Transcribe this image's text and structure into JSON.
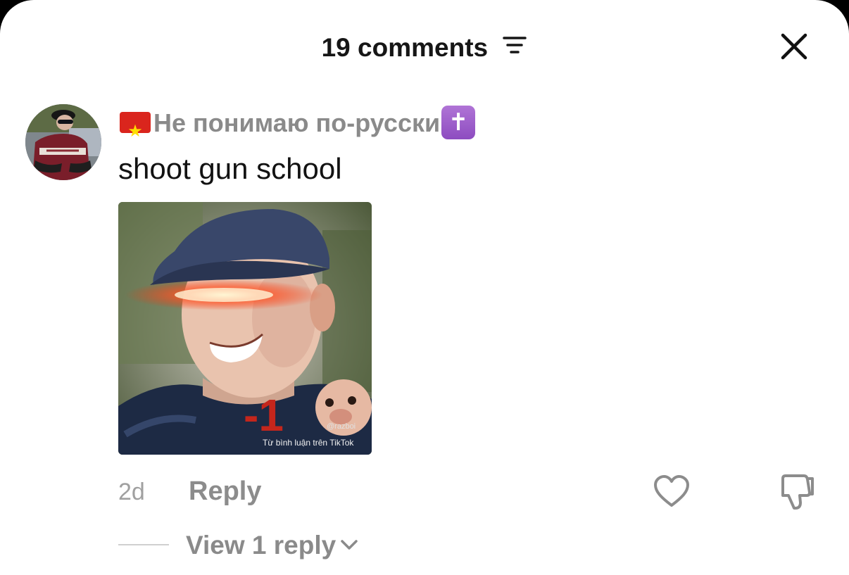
{
  "header": {
    "title": "19 comments"
  },
  "comment": {
    "username": "Не понимаю по-русски",
    "username_prefix_icon": "vietnam-flag-emoji",
    "username_suffix_icon": "latin-cross-emoji",
    "text": "shoot gun school",
    "media": {
      "watermark_handle": "@razboi",
      "watermark_caption": "Từ bình luận trên TikTok",
      "overlay_number": "-1"
    },
    "time": "2d",
    "reply_label": "Reply",
    "view_replies_label": "View 1 reply"
  },
  "colors": {
    "background": "#ffffff",
    "text": "#121212",
    "muted": "#8a8a8a",
    "flag_red": "#da251d",
    "flag_star": "#ffde00",
    "cross_purple": "#9b5bc9"
  }
}
